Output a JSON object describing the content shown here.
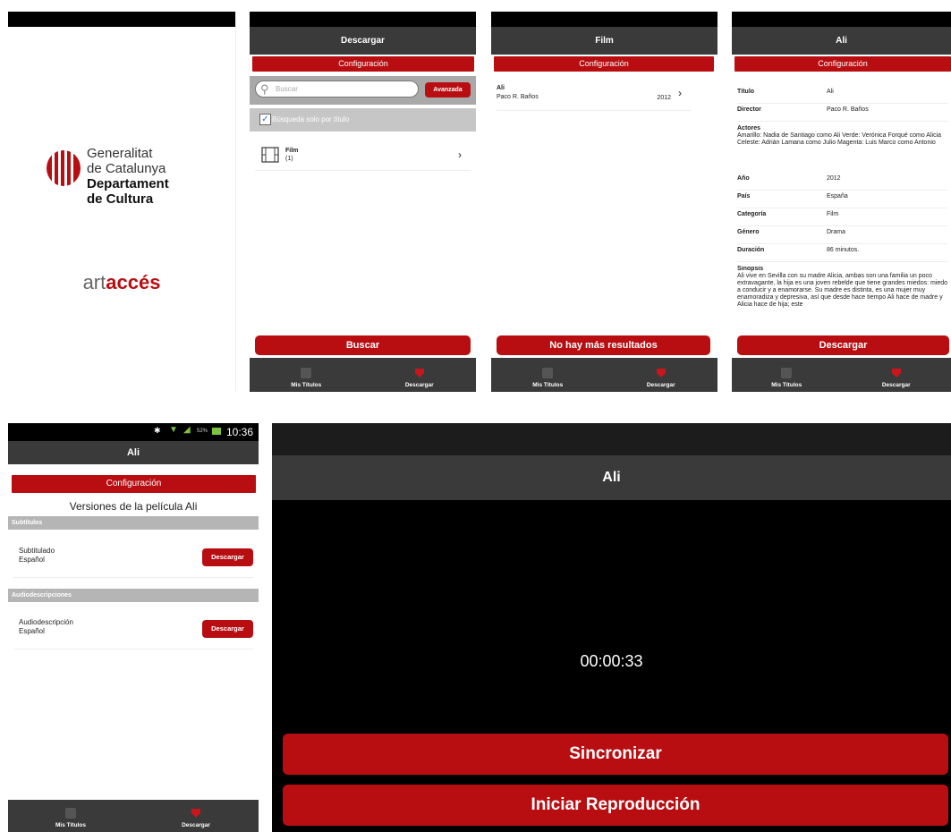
{
  "splash": {
    "org_line1": "Generalitat",
    "org_line2": "de Catalunya",
    "org_line3": "Departament",
    "org_line4": "de Cultura",
    "brand_art": "art",
    "brand_acces": "accés"
  },
  "common": {
    "config_label": "Configuración",
    "nav_my_titles": "Mis Títulos",
    "nav_download": "Descargar",
    "accent": "#b80e12",
    "bar": "#3a3a3a"
  },
  "search_screen": {
    "title": "Descargar",
    "search_placeholder": "Buscar",
    "advanced_label": "Avanzada",
    "title_only_label": "Búsqueda solo por título",
    "result_label": "Film",
    "result_count": "(1)",
    "search_button": "Buscar"
  },
  "film_screen": {
    "title": "Film",
    "item_title": "Ali",
    "item_director": "Paco R. Baños",
    "item_year": "2012",
    "no_more_button": "No hay más resultados"
  },
  "detail_screen": {
    "title": "Ali",
    "rows": [
      {
        "k": "Título",
        "v": "Ali"
      },
      {
        "k": "Director",
        "v": "Paco R. Baños"
      }
    ],
    "actors_label": "Actores",
    "actors_text": "Amarillo: Nadia de Santiago como Ali Verde: Verónica Forqué como Alicia Celeste: Adrián Lamana como Julio Magenta: Luis Marco como Antonio",
    "rows2": [
      {
        "k": "Año",
        "v": "2012"
      },
      {
        "k": "País",
        "v": "España"
      },
      {
        "k": "Categoría",
        "v": "Film"
      },
      {
        "k": "Género",
        "v": "Drama"
      },
      {
        "k": "Duración",
        "v": "86 minutos."
      }
    ],
    "synopsis_label": "Sinopsis",
    "synopsis_text": "Ali vive en Sevilla con su madre Alicia, ambas son una familia un poco extravagante, la hija es una joven rebelde que tiene grandes miedos: miedo a conducir y a enamorarse. Su madre es distinta, es una mujer muy enamoradiza y depresiva, así que desde hace tiempo Ali hace de madre y Alicia hace de hija; este",
    "download_button": "Descargar"
  },
  "versions_screen": {
    "status_time": "10:36",
    "status_battery": "52%",
    "title": "Ali",
    "heading": "Versiones de la película Ali",
    "subs_section": "Subtítulos",
    "subs_item_line1": "Subtitulado",
    "subs_item_line2": "Español",
    "audio_section": "Audiodescripciones",
    "audio_item_line1": "Audiodescripción",
    "audio_item_line2": "Español",
    "download_label": "Descargar"
  },
  "player_screen": {
    "title": "Ali",
    "timer": "00:00:33",
    "sync_button": "Sincronizar",
    "play_button": "Iniciar Reproducción"
  }
}
